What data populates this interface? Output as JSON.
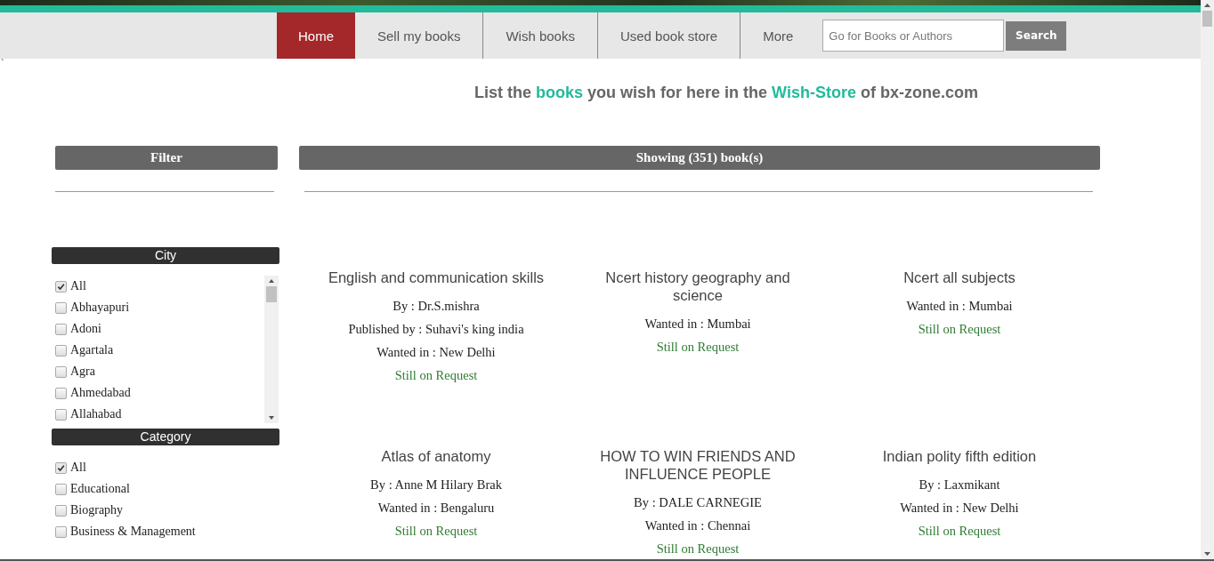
{
  "nav": {
    "items": [
      {
        "label": "Home",
        "selected": true
      },
      {
        "label": "Sell my books",
        "selected": false
      },
      {
        "label": "Wish books",
        "selected": false
      },
      {
        "label": "Used book store",
        "selected": false
      },
      {
        "label": "More",
        "selected": false
      }
    ],
    "search": {
      "placeholder": "Go for Books or Authors",
      "button": "Search"
    }
  },
  "stray_mark": "`",
  "headline": [
    {
      "text": "List the ",
      "highlight": false
    },
    {
      "text": "books",
      "highlight": true
    },
    {
      "text": " you wish for here in the ",
      "highlight": false
    },
    {
      "text": "Wish-Store",
      "highlight": true
    },
    {
      "text": " of bx-zone.com",
      "highlight": false
    }
  ],
  "filter": {
    "title": "Filter",
    "groups": [
      {
        "title": "City",
        "scrollable": true,
        "options": [
          {
            "label": "All",
            "checked": true
          },
          {
            "label": "Abhayapuri",
            "checked": false
          },
          {
            "label": "Adoni",
            "checked": false
          },
          {
            "label": "Agartala",
            "checked": false
          },
          {
            "label": "Agra",
            "checked": false
          },
          {
            "label": "Ahmedabad",
            "checked": false
          },
          {
            "label": "Allahabad",
            "checked": false
          }
        ]
      },
      {
        "title": "Category",
        "scrollable": false,
        "options": [
          {
            "label": "All",
            "checked": true
          },
          {
            "label": "Educational",
            "checked": false
          },
          {
            "label": "Biography",
            "checked": false
          },
          {
            "label": "Business & Management",
            "checked": false
          }
        ]
      }
    ]
  },
  "results": {
    "title": "Showing (351) book(s)",
    "books": [
      {
        "title": "English and communication skills",
        "author": "By : Dr.S.mishra",
        "publisher": "Published by : Suhavi's king india",
        "wanted_in": "Wanted in : New Delhi",
        "status": "Still on Request"
      },
      {
        "title": "Ncert history geography and science",
        "wanted_in": "Wanted in : Mumbai",
        "status": "Still on Request"
      },
      {
        "title": "Ncert all subjects",
        "wanted_in": "Wanted in : Mumbai",
        "status": "Still on Request"
      },
      {
        "title": "Atlas of anatomy",
        "author": "By : Anne M Hilary Brak",
        "wanted_in": "Wanted in : Bengaluru",
        "status": "Still on Request"
      },
      {
        "title": "HOW TO WIN FRIENDS AND INFLUENCE PEOPLE",
        "author": "By : DALE CARNEGIE",
        "wanted_in": "Wanted in : Chennai",
        "status": "Still on Request"
      },
      {
        "title": "Indian polity fifth edition",
        "author": "By : Laxmikant",
        "wanted_in": "Wanted in : New Delhi",
        "status": "Still on Request"
      }
    ]
  }
}
